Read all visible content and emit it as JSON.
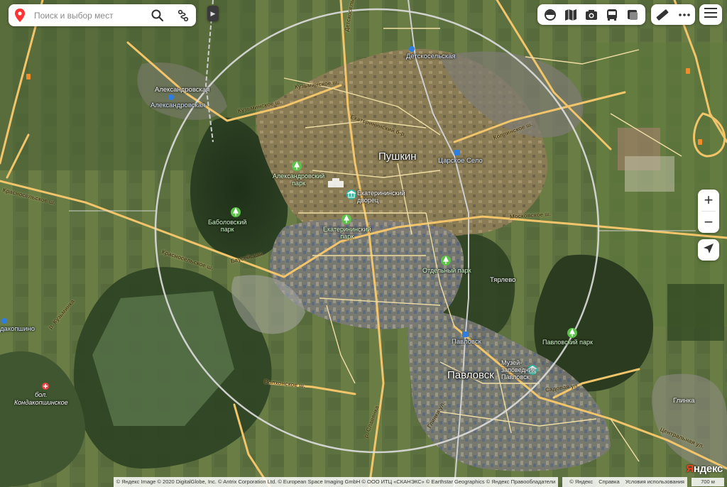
{
  "search": {
    "placeholder": "Поиск и выбор мест"
  },
  "colors": {
    "pin": "#f33",
    "road_major": "#f7c96e",
    "road_minor": "#f3e1a3",
    "railway": "#c8c8c8",
    "circle": "#d9d9d9",
    "park_icon": "#5cc24a",
    "station_icon": "#2e7de0",
    "museum_icon": "#2fb4a0"
  },
  "map_type": "satellite-hybrid",
  "labels": {
    "cities": {
      "pushkin": "Пушкин",
      "pavlovsk": "Павловск"
    },
    "settlements": {
      "aleksandrovskaya": "Александровская",
      "tyarlevo": "Тярлево",
      "glinka": "Глинка"
    },
    "stations": {
      "aleksandrovskaya": "Александровская",
      "detskoselskaya": "Детскосельская",
      "tsarskoe_selo": "Царское Село",
      "pavlovsk": "Павловск",
      "kondakopshino": "дакопшино"
    },
    "parks": {
      "aleksandrovsky": [
        "Александровский",
        "парк"
      ],
      "babolovsky": [
        "Баболовский",
        "парк"
      ],
      "ekaterininsky": [
        "Екатерининский",
        "парк"
      ],
      "otdelny": "Отдельный парк",
      "pavlovsky": "Павловский парк"
    },
    "poi": {
      "palace": [
        "Екатерининский",
        "дворец"
      ],
      "museum": [
        "Музей-",
        "заповедник",
        "Павловск"
      ]
    },
    "hospital": [
      "бол.",
      "Кондакопшинское"
    ],
    "streets": {
      "kuzminskoe": "Кузьминское ш.",
      "kuzminskoe2": "Кузьминское ш.",
      "detskoselsky": "Детскосельский б-р",
      "ekaterininsky": "Екатерининский б-р",
      "kolpinskoe": "Колпинское ш.",
      "moskovskoe": "Московское ш.",
      "bauskaya": "Баусейская",
      "krasnoselskoe": "Красносельское ш.",
      "novoselskoe": "Красносельское ш.",
      "sadovaya": "Садовая ул.",
      "tsentralnaya": "Центральная ул.",
      "volkhonskoe": "Волхонское ш.",
      "kuzmolovka": "р. Кузьминка",
      "slavyanka": "р. Славянка",
      "glinka_rd": "Глинки ул."
    }
  },
  "footer": {
    "attribution": "© Яндекс Image © 2020 DigitalGlobe, Inc. © Antrix Corporation Ltd. © European Space Imaging GmbH © ООО ИТЦ «СКАНЭКС» © Earthstar Geographics © Яндекс   Правообладатели",
    "links": {
      "copyright": "© Яндекс",
      "help": "Справка",
      "terms": "Условия использования"
    },
    "scale": "700 м",
    "logo": "Яндекс"
  }
}
